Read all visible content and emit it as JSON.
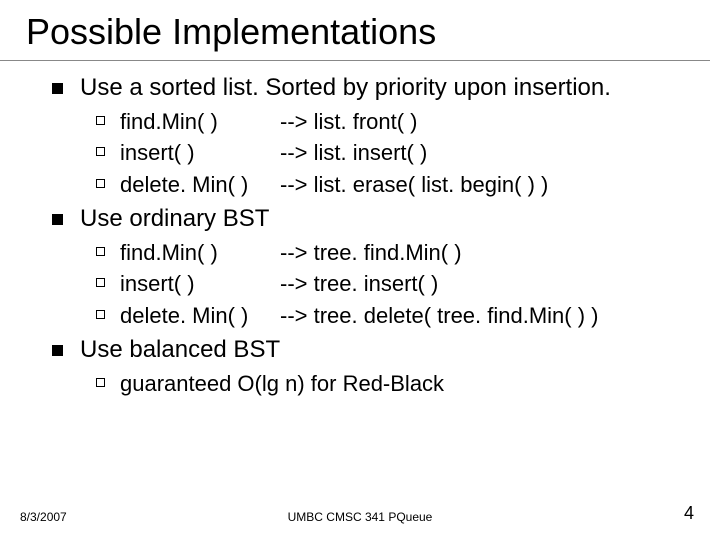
{
  "title": "Possible Implementations",
  "items": [
    {
      "text": "Use a sorted list. Sorted by priority upon insertion.",
      "sub": [
        {
          "op": "find.Min( )",
          "map": "--> list. front( )"
        },
        {
          "op": "insert( )",
          "map": "--> list. insert( )"
        },
        {
          "op": "delete. Min( )",
          "map": "--> list. erase( list. begin( ) )"
        }
      ]
    },
    {
      "text": "Use ordinary BST",
      "sub": [
        {
          "op": "find.Min( )",
          "map": "--> tree. find.Min( )"
        },
        {
          "op": "insert( )",
          "map": "--> tree. insert( )"
        },
        {
          "op": "delete. Min( )",
          "map": "--> tree. delete( tree. find.Min( ) )"
        }
      ]
    },
    {
      "text": "Use balanced BST",
      "sub": [
        {
          "single": "guaranteed O(lg n) for Red-Black"
        }
      ]
    }
  ],
  "footer": {
    "date": "8/3/2007",
    "center": "UMBC CMSC 341 PQueue",
    "page": "4"
  }
}
